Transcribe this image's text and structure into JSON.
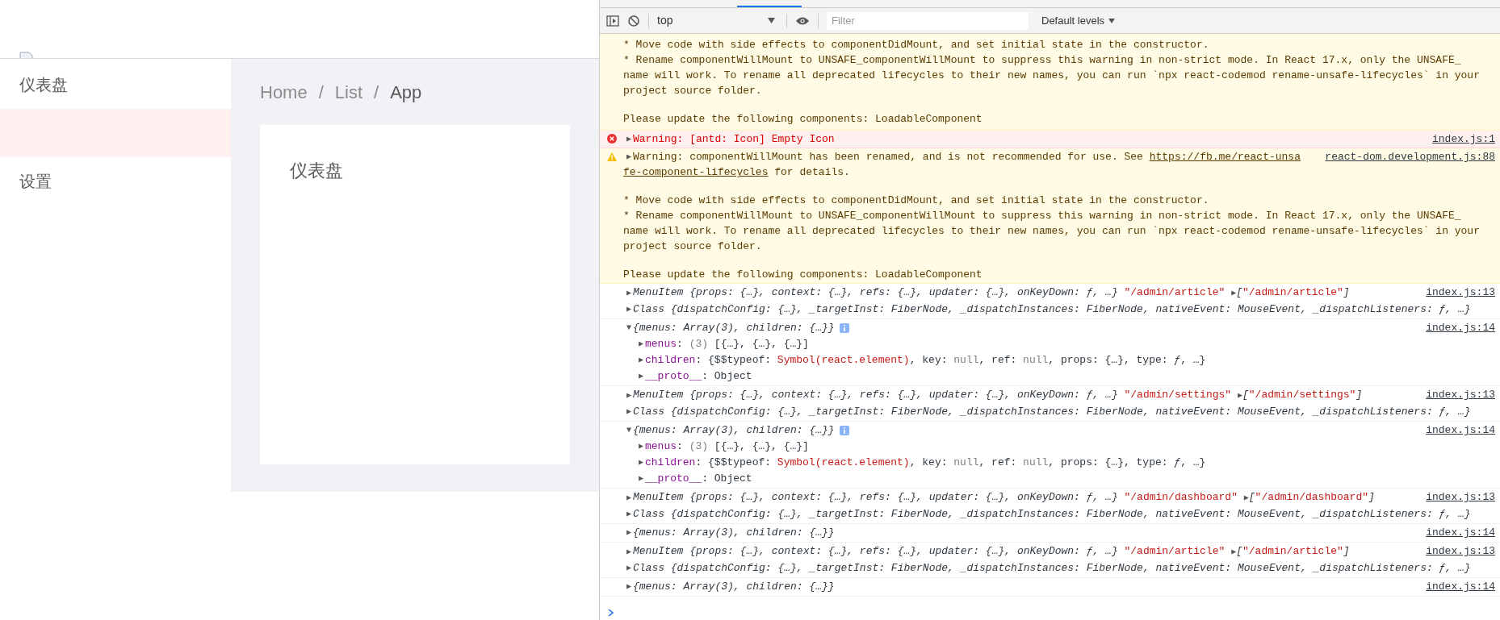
{
  "sidebar": {
    "items": [
      {
        "label": "仪表盘",
        "selected": false
      },
      {
        "selected": true
      },
      {
        "label": "设置",
        "selected": false
      }
    ]
  },
  "breadcrumb": [
    {
      "label": "Home",
      "separator": "/"
    },
    {
      "label": "List",
      "separator": "/"
    },
    {
      "label": "App"
    }
  ],
  "content": {
    "card_text": "仪表盘"
  },
  "devtools": {
    "toolbar": {
      "context": "top",
      "filter_placeholder": "Filter",
      "levels": "Default levels"
    },
    "messages": [
      {
        "kind": "warning-cont",
        "paragraphs": [
          [
            [
              {
                "text": "* Move code with side effects to componentDidMount, and set initial state in the constructor."
              }
            ],
            [
              {
                "text": "* Rename componentWillMount to UNSAFE_componentWillMount to suppress this warning in non-strict mode. In React 17.x, only the UNSAFE_"
              }
            ],
            [
              {
                "text": "name will work. To rename all deprecated lifecycles to their new names, you can run `npx react-codemod rename-unsafe-lifecycles` in your"
              }
            ],
            [
              {
                "text": "project source folder."
              }
            ]
          ],
          [
            [
              {
                "text": "Please update the following components: LoadableComponent"
              }
            ]
          ]
        ]
      },
      {
        "kind": "error",
        "source": "index.js:1",
        "arrow": "▶",
        "paragraphs": [
          [
            [
              {
                "text": "Warning: [antd: Icon] Empty Icon"
              }
            ]
          ]
        ]
      },
      {
        "kind": "warning",
        "source": "react-dom.development.js:88",
        "arrow": "▶",
        "paragraphs": [
          [
            [
              {
                "text": "Warning: componentWillMount has been renamed, and is not recommended for use. See "
              },
              {
                "text": "https://fb.me/react-unsa",
                "kind": "link"
              }
            ],
            [
              {
                "text": "fe-component-lifecycles",
                "kind": "link"
              },
              {
                "text": " for details."
              }
            ]
          ],
          [
            [
              {
                "text": "* Move code with side effects to componentDidMount, and set initial state in the constructor."
              }
            ],
            [
              {
                "text": "* Rename componentWillMount to UNSAFE_componentWillMount to suppress this warning in non-strict mode. In React 17.x, only the UNSAFE_"
              }
            ],
            [
              {
                "text": "name will work. To rename all deprecated lifecycles to their new names, you can run `npx react-codemod rename-unsafe-lifecycles` in your"
              }
            ],
            [
              {
                "text": "project source folder."
              }
            ]
          ],
          [
            [
              {
                "text": "Please update the following components: LoadableComponent"
              }
            ]
          ]
        ]
      },
      {
        "kind": "log",
        "source": "index.js:13",
        "lines": [
          {
            "arrow": "▶",
            "tokens": [
              {
                "text": "MenuItem {props: {…}, context: {…}, refs: {…}, updater: {…}, onKeyDown: ƒ, …}",
                "kind": "object"
              },
              {
                "text": " \"/admin/article\" ",
                "kind": "string"
              },
              {
                "text": "▶",
                "kind": "toggle"
              },
              {
                "text": "[",
                "kind": "object"
              },
              {
                "text": "\"/admin/article\"",
                "kind": "string"
              },
              {
                "text": "]",
                "kind": "object"
              }
            ]
          },
          {
            "arrow": "▶",
            "tokens": [
              {
                "text": "Class {dispatchConfig: {…}, _targetInst: FiberNode, _dispatchInstances: FiberNode, nativeEvent: MouseEvent, _dispatchListeners: ƒ, …}",
                "kind": "object"
              }
            ]
          }
        ]
      },
      {
        "kind": "log",
        "source": "index.js:14",
        "lines": [
          {
            "arrow": "▼",
            "info": true,
            "tokens": [
              {
                "text": "{menus: Array(3), children: {…}}",
                "kind": "object"
              }
            ],
            "children": [
              {
                "arrow": "▶",
                "tokens": [
                  {
                    "text": "menus",
                    "kind": "property"
                  },
                  {
                    "text": ": "
                  },
                  {
                    "text": "(3) ",
                    "kind": "meta"
                  },
                  {
                    "text": "[{…}, {…}, {…}]"
                  }
                ]
              },
              {
                "arrow": "▶",
                "tokens": [
                  {
                    "text": "children",
                    "kind": "property"
                  },
                  {
                    "text": ": {$$typeof: "
                  },
                  {
                    "text": "Symbol(react.element)",
                    "kind": "string"
                  },
                  {
                    "text": ", key: "
                  },
                  {
                    "text": "null",
                    "kind": "meta"
                  },
                  {
                    "text": ", ref: "
                  },
                  {
                    "text": "null",
                    "kind": "meta"
                  },
                  {
                    "text": ", props: {…}, type: "
                  },
                  {
                    "text": "ƒ",
                    "kind": "object"
                  },
                  {
                    "text": ", …}"
                  }
                ]
              },
              {
                "arrow": "▶",
                "tokens": [
                  {
                    "text": "__proto__",
                    "kind": "property"
                  },
                  {
                    "text": ": Object"
                  }
                ]
              }
            ]
          }
        ]
      },
      {
        "kind": "log",
        "source": "index.js:13",
        "lines": [
          {
            "arrow": "▶",
            "tokens": [
              {
                "text": "MenuItem {props: {…}, context: {…}, refs: {…}, updater: {…}, onKeyDown: ƒ, …}",
                "kind": "object"
              },
              {
                "text": " \"/admin/settings\" ",
                "kind": "string"
              },
              {
                "text": "▶",
                "kind": "toggle"
              },
              {
                "text": "[",
                "kind": "object"
              },
              {
                "text": "\"/admin/settings\"",
                "kind": "string"
              },
              {
                "text": "]",
                "kind": "object"
              }
            ]
          },
          {
            "arrow": "▶",
            "tokens": [
              {
                "text": "Class {dispatchConfig: {…}, _targetInst: FiberNode, _dispatchInstances: FiberNode, nativeEvent: MouseEvent, _dispatchListeners: ƒ, …}",
                "kind": "object"
              }
            ]
          }
        ]
      },
      {
        "kind": "log",
        "source": "index.js:14",
        "lines": [
          {
            "arrow": "▼",
            "info": true,
            "tokens": [
              {
                "text": "{menus: Array(3), children: {…}}",
                "kind": "object"
              }
            ],
            "children": [
              {
                "arrow": "▶",
                "tokens": [
                  {
                    "text": "menus",
                    "kind": "property"
                  },
                  {
                    "text": ": "
                  },
                  {
                    "text": "(3) ",
                    "kind": "meta"
                  },
                  {
                    "text": "[{…}, {…}, {…}]"
                  }
                ]
              },
              {
                "arrow": "▶",
                "tokens": [
                  {
                    "text": "children",
                    "kind": "property"
                  },
                  {
                    "text": ": {$$typeof: "
                  },
                  {
                    "text": "Symbol(react.element)",
                    "kind": "string"
                  },
                  {
                    "text": ", key: "
                  },
                  {
                    "text": "null",
                    "kind": "meta"
                  },
                  {
                    "text": ", ref: "
                  },
                  {
                    "text": "null",
                    "kind": "meta"
                  },
                  {
                    "text": ", props: {…}, type: "
                  },
                  {
                    "text": "ƒ",
                    "kind": "object"
                  },
                  {
                    "text": ", …}"
                  }
                ]
              },
              {
                "arrow": "▶",
                "tokens": [
                  {
                    "text": "__proto__",
                    "kind": "property"
                  },
                  {
                    "text": ": Object"
                  }
                ]
              }
            ]
          }
        ]
      },
      {
        "kind": "log",
        "source": "index.js:13",
        "lines": [
          {
            "arrow": "▶",
            "tokens": [
              {
                "text": "MenuItem {props: {…}, context: {…}, refs: {…}, updater: {…}, onKeyDown: ƒ, …}",
                "kind": "object"
              },
              {
                "text": " \"/admin/dashboard\" ",
                "kind": "string"
              },
              {
                "text": "▶",
                "kind": "toggle"
              },
              {
                "text": "[",
                "kind": "object"
              },
              {
                "text": "\"/admin/dashboard\"",
                "kind": "string"
              },
              {
                "text": "]",
                "kind": "object"
              }
            ]
          },
          {
            "arrow": "▶",
            "tokens": [
              {
                "text": "Class {dispatchConfig: {…}, _targetInst: FiberNode, _dispatchInstances: FiberNode, nativeEvent: MouseEvent, _dispatchListeners: ƒ, …}",
                "kind": "object"
              }
            ]
          }
        ]
      },
      {
        "kind": "log",
        "source": "index.js:14",
        "lines": [
          {
            "arrow": "▶",
            "tokens": [
              {
                "text": "{menus: Array(3), children: {…}}",
                "kind": "object"
              }
            ]
          }
        ]
      },
      {
        "kind": "log",
        "source": "index.js:13",
        "lines": [
          {
            "arrow": "▶",
            "tokens": [
              {
                "text": "MenuItem {props: {…}, context: {…}, refs: {…}, updater: {…}, onKeyDown: ƒ, …}",
                "kind": "object"
              },
              {
                "text": " \"/admin/article\" ",
                "kind": "string"
              },
              {
                "text": "▶",
                "kind": "toggle"
              },
              {
                "text": "[",
                "kind": "object"
              },
              {
                "text": "\"/admin/article\"",
                "kind": "string"
              },
              {
                "text": "]",
                "kind": "object"
              }
            ]
          },
          {
            "arrow": "▶",
            "tokens": [
              {
                "text": "Class {dispatchConfig: {…}, _targetInst: FiberNode, _dispatchInstances: FiberNode, nativeEvent: MouseEvent, _dispatchListeners: ƒ, …}",
                "kind": "object"
              }
            ]
          }
        ]
      },
      {
        "kind": "log",
        "source": "index.js:14",
        "lines": [
          {
            "arrow": "▶",
            "tokens": [
              {
                "text": "{menus: Array(3), children: {…}}",
                "kind": "object"
              }
            ]
          }
        ]
      }
    ]
  }
}
